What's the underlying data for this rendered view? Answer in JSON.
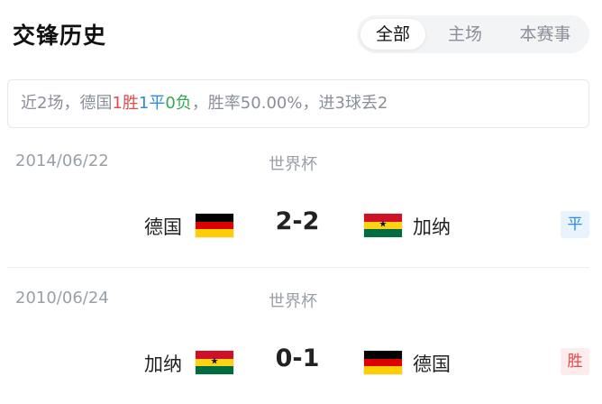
{
  "header": {
    "title": "交锋历史",
    "tabs": [
      {
        "label": "全部",
        "active": true
      },
      {
        "label": "主场",
        "active": false
      },
      {
        "label": "本赛事",
        "active": false
      }
    ]
  },
  "summary": {
    "prefix": "近2场，德国",
    "wins": "1胜",
    "draws": "1平",
    "losses": "0负",
    "suffix": "，胜率50.00%，进3球丢2"
  },
  "matches": [
    {
      "date": "2014/06/22",
      "competition": "世界杯",
      "home": "德国",
      "home_flag": "germany-flag",
      "score": "2-2",
      "away": "加纳",
      "away_flag": "ghana-flag",
      "result": "平",
      "result_color": "#2f8ae3"
    },
    {
      "date": "2010/06/24",
      "competition": "世界杯",
      "home": "加纳",
      "home_flag": "ghana-flag",
      "score": "0-1",
      "away": "德国",
      "away_flag": "germany-flag",
      "result": "胜",
      "result_color": "#e34a4a"
    }
  ],
  "colors": {
    "win": "#e34a4a",
    "draw": "#2f8ae3",
    "loss": "#33a852",
    "germany": [
      "#000000",
      "#dd0000",
      "#ffce00"
    ],
    "ghana": [
      "#ce1126",
      "#fcd116",
      "#006b3f"
    ]
  }
}
